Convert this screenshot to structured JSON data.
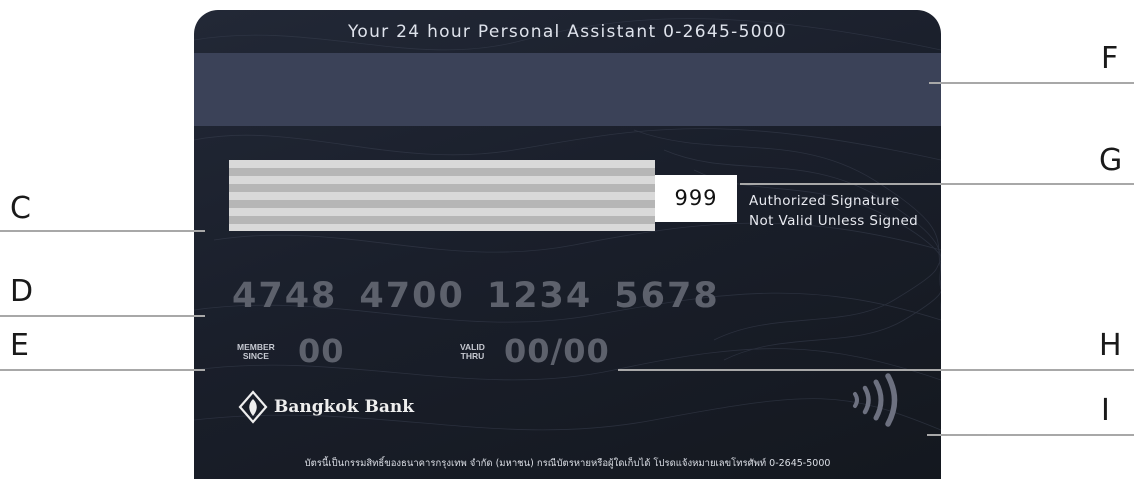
{
  "card": {
    "hotline": "Your 24 hour Personal Assistant 0-2645-5000",
    "cvv": "999",
    "signature_note": [
      "Authorized Signature",
      "Not Valid Unless Signed"
    ],
    "card_number_groups": [
      "4748",
      "4700",
      "1234",
      "5678"
    ],
    "member_since_label": [
      "MEMBER",
      "SINCE"
    ],
    "member_since_value": "00",
    "valid_thru_label": [
      "VALID",
      "THRU"
    ],
    "valid_thru_value": "00/00",
    "bank_name": "Bangkok Bank",
    "footer_note": "บัตรนี้เป็นกรรมสิทธิ์ของธนาคารกรุงเทพ จำกัด (มหาชน) กรณีบัตรหายหรือผู้ใดเก็บได้ โปรดแจ้งหมายเลขโทรศัพท์ 0-2645-5000"
  },
  "callouts": {
    "C": "C",
    "D": "D",
    "E": "E",
    "F": "F",
    "G": "G",
    "H": "H",
    "I": "I"
  },
  "colors": {
    "card_background": "#1a1f2b",
    "magnetic_stripe": "#3b4258",
    "embossed_text": "#5d616c",
    "callout_line": "#a8a8a8"
  }
}
